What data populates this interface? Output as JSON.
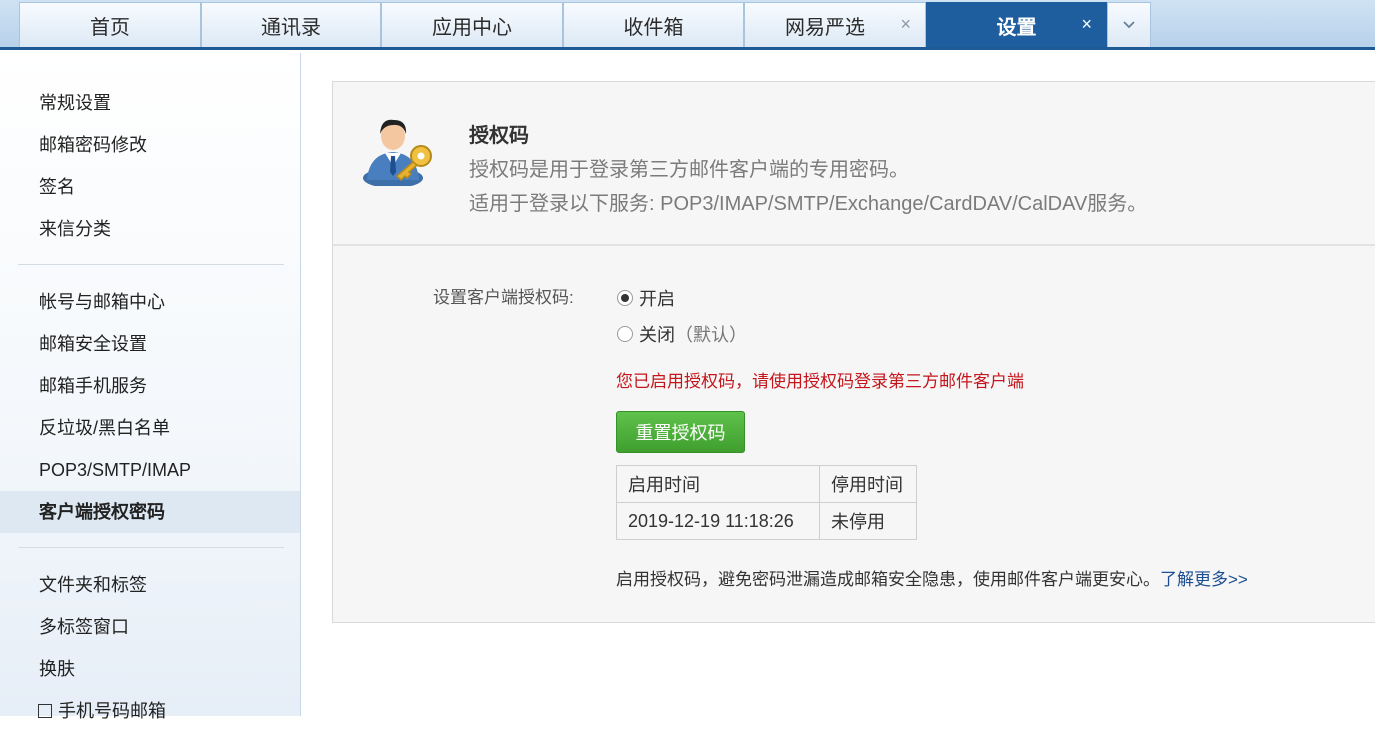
{
  "tabs": [
    {
      "label": "首页",
      "closable": false,
      "active": false
    },
    {
      "label": "通讯录",
      "closable": false,
      "active": false
    },
    {
      "label": "应用中心",
      "closable": false,
      "active": false
    },
    {
      "label": "收件箱",
      "closable": false,
      "active": false
    },
    {
      "label": "网易严选",
      "closable": true,
      "active": false
    },
    {
      "label": "设置",
      "closable": true,
      "active": true
    }
  ],
  "tab_close_glyph": "×",
  "sidebar": {
    "group1": [
      "常规设置",
      "邮箱密码修改",
      "签名",
      "来信分类"
    ],
    "group2": [
      "帐号与邮箱中心",
      "邮箱安全设置",
      "邮箱手机服务",
      "反垃圾/黑白名单",
      "POP3/SMTP/IMAP",
      "客户端授权密码"
    ],
    "group3": [
      "文件夹和标签",
      "多标签窗口",
      "换肤",
      "手机号码邮箱"
    ],
    "active_item": "客户端授权密码"
  },
  "auth": {
    "title": "授权码",
    "desc1": "授权码是用于登录第三方邮件客户端的专用密码。",
    "desc2": "适用于登录以下服务: POP3/IMAP/SMTP/Exchange/CardDAV/CalDAV服务。",
    "setting_label": "设置客户端授权码:",
    "option_on": "开启",
    "option_off": "关闭",
    "option_off_hint": "（默认）",
    "selected": "开启",
    "status_msg": "您已启用授权码，请使用授权码登录第三方邮件客户端",
    "reset_button": "重置授权码",
    "table": {
      "headers": [
        "启用时间",
        "停用时间"
      ],
      "rows": [
        [
          "2019-12-19 11:18:26",
          "未停用"
        ]
      ]
    },
    "footer_text": "启用授权码，避免密码泄漏造成邮箱安全隐患，使用邮件客户端更安心。",
    "learn_more": "了解更多>>"
  },
  "colors": {
    "active_tab": "#1f5e9e",
    "warning": "#c4161c",
    "button_green": "#4cae38",
    "link": "#1d4f91"
  },
  "icons": [
    "close-icon",
    "chevron-down-icon",
    "user-key-icon",
    "checkbox-icon"
  ]
}
